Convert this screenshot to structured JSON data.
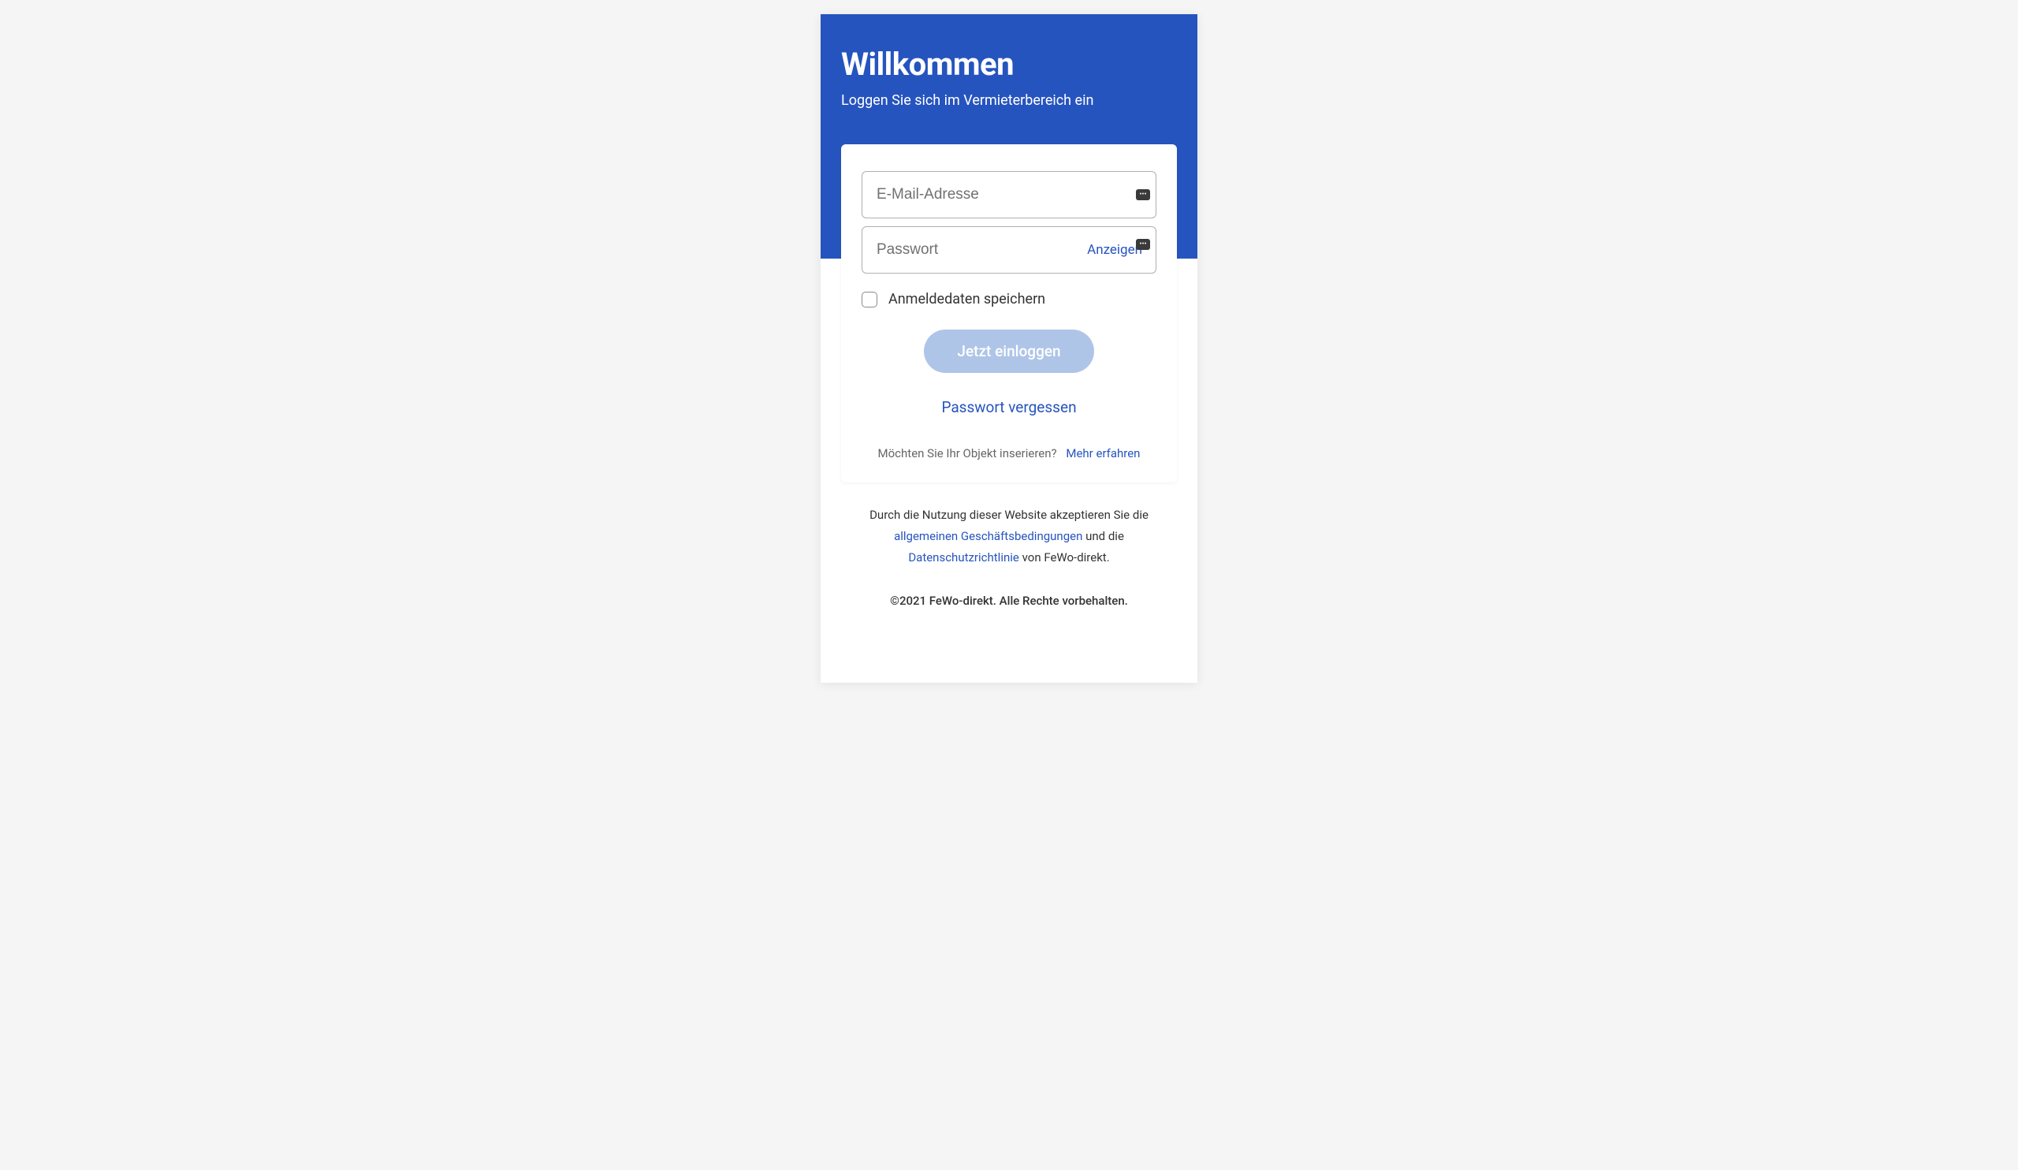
{
  "header": {
    "title": "Willkommen",
    "subtitle": "Loggen Sie sich im Vermieterbereich ein"
  },
  "form": {
    "email_placeholder": "E-Mail-Adresse",
    "password_placeholder": "Passwort",
    "show_password_label": "Anzeigen",
    "remember_label": "Anmeldedaten speichern",
    "login_button": "Jetzt einloggen",
    "forgot_password": "Passwort vergessen"
  },
  "cta": {
    "prompt": "Möchten Sie Ihr Objekt inserieren?",
    "link": "Mehr erfahren"
  },
  "footer": {
    "terms_prefix": "Durch die Nutzung dieser Website akzeptieren Sie die ",
    "terms_link": "allgemeinen Geschäftsbedingungen",
    "terms_middle": " und die ",
    "privacy_link": "Datenschutzrichtlinie",
    "terms_suffix": " von FeWo-direkt.",
    "copyright": "©2021 FeWo-direkt. Alle Rechte vorbehalten."
  }
}
